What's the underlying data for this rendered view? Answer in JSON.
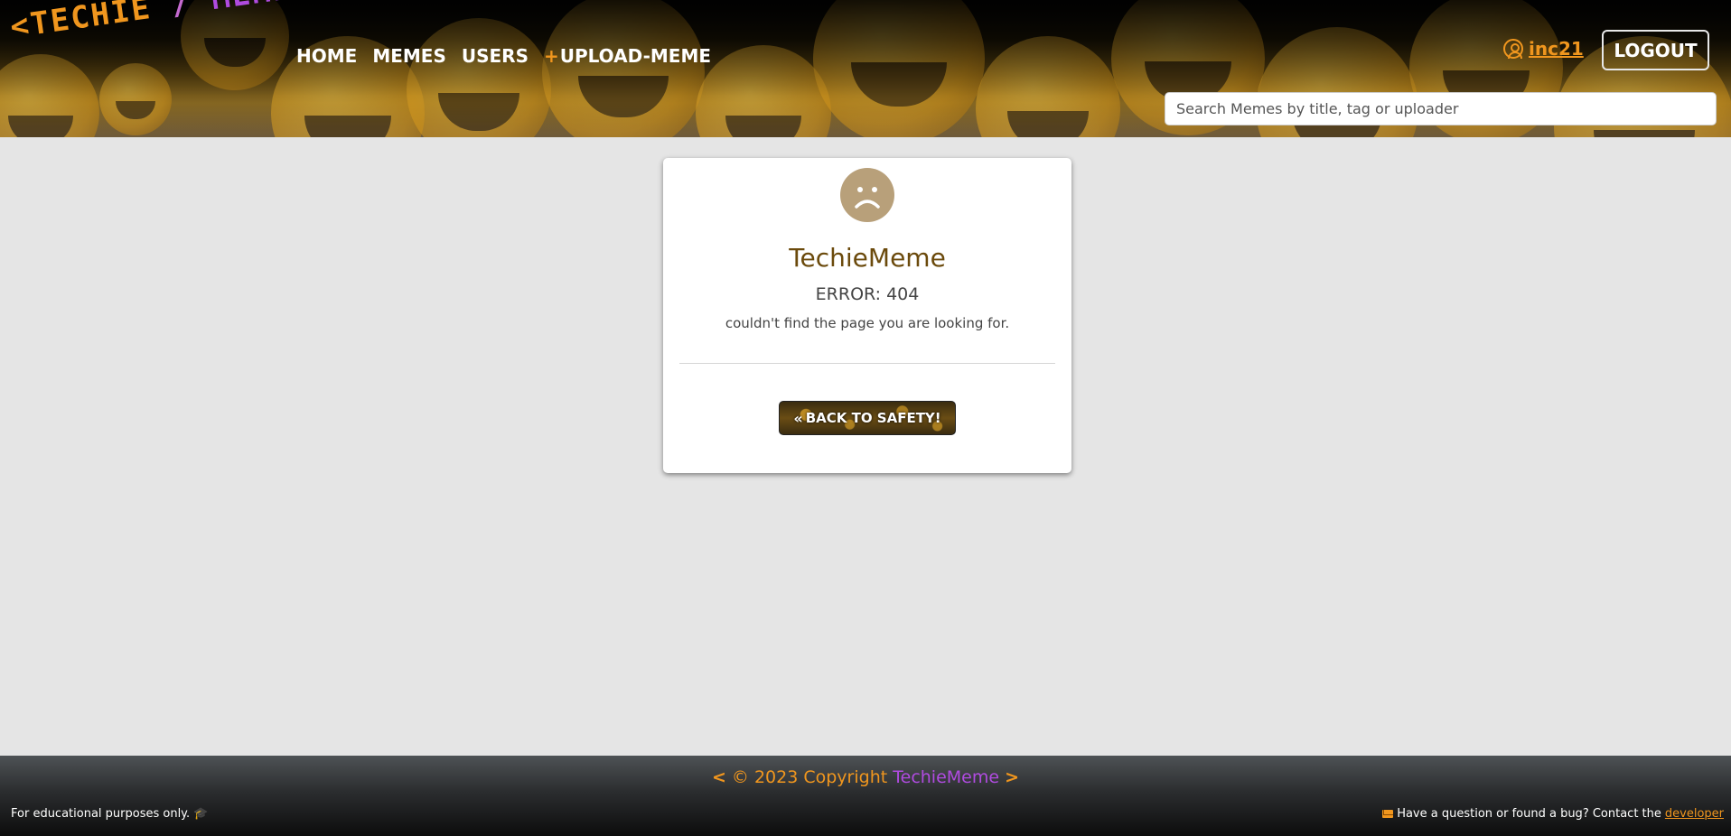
{
  "header": {
    "logo": {
      "open_bracket": "<",
      "word1": "TECHIE",
      "slash": "/",
      "word2": "MEME",
      "close_bracket": ">"
    },
    "nav": {
      "home": "HOME",
      "memes": "MEMES",
      "users": "USERS",
      "upload_plus": "+",
      "upload": "UPLOAD-MEME"
    },
    "user": {
      "icon": "user-circle-icon",
      "username": "inc21"
    },
    "logout_label": "LOGOUT",
    "search": {
      "placeholder": "Search Memes by title, tag or uploader",
      "value": ""
    }
  },
  "error_card": {
    "icon": "sad-face-icon",
    "title": "TechieMeme",
    "error": "ERROR: 404",
    "message": "couldn't find the page you are looking for.",
    "button_icon": "double-chevron-left-icon",
    "button_label": "BACK TO SAFETY!"
  },
  "footer": {
    "chev_left": "<",
    "copyright": "© 2023 Copyright",
    "brand": "TechieMeme",
    "chev_right": ">",
    "left_text": "For educational purposes only.",
    "left_icon": "graduation-cap-icon",
    "right_icon": "envelope-icon",
    "right_text": "Have a question or found a bug? Contact the",
    "right_link": "developer"
  },
  "colors": {
    "accent_orange": "#f0961e",
    "accent_purple": "#b04be0",
    "page_bg": "#e5e5e5",
    "title_brown": "#6b4a0c",
    "sad_face": "#b8a07a"
  }
}
